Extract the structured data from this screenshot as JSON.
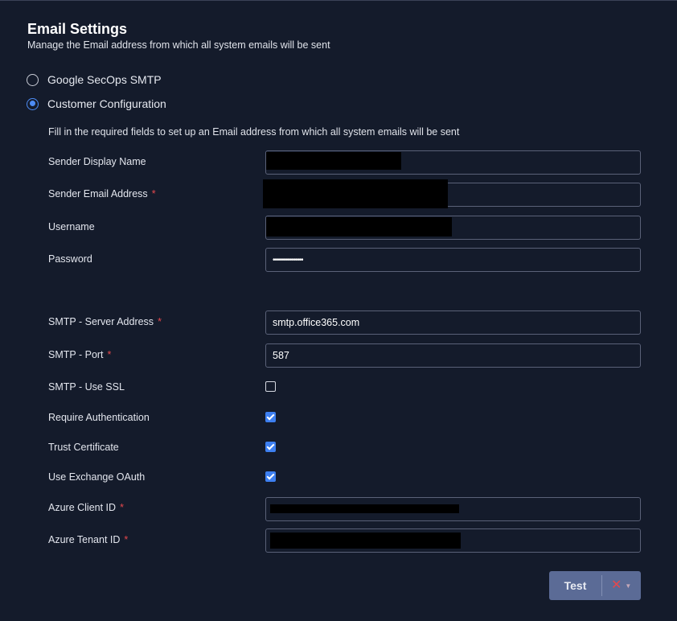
{
  "header": {
    "title": "Email Settings",
    "subtitle": "Manage the Email address from which all system emails will be sent"
  },
  "options": {
    "google": "Google SecOps SMTP",
    "customer": "Customer Configuration",
    "selected": "customer"
  },
  "hint": "Fill in the required fields to set up an Email address from which all system emails will be sent",
  "fields": {
    "sender_display_name": {
      "label": "Sender Display Name",
      "value": ""
    },
    "sender_email": {
      "label": "Sender Email Address",
      "required": "*",
      "value": ""
    },
    "username": {
      "label": "Username",
      "value": ""
    },
    "password": {
      "label": "Password",
      "value": "•••••••••••••••"
    },
    "smtp_server": {
      "label": "SMTP - Server Address",
      "required": "*",
      "value": "smtp.office365.com"
    },
    "smtp_port": {
      "label": "SMTP - Port",
      "required": "*",
      "value": "587"
    },
    "azure_client_id": {
      "label": "Azure Client ID",
      "required": "*",
      "value": ""
    },
    "azure_tenant_id": {
      "label": "Azure Tenant ID",
      "required": "*",
      "value": ""
    }
  },
  "checkboxes": {
    "use_ssl": {
      "label": "SMTP - Use SSL",
      "checked": false
    },
    "require_auth": {
      "label": "Require Authentication",
      "checked": true
    },
    "trust_cert": {
      "label": "Trust Certificate",
      "checked": true
    },
    "exchange_oauth": {
      "label": "Use Exchange OAuth",
      "checked": true
    }
  },
  "actions": {
    "test_label": "Test",
    "status_icon": "x-icon",
    "dropdown_icon": "chevron-down-icon"
  },
  "colors": {
    "background": "#141b2b",
    "accent": "#3d7ff0",
    "required": "#e5484d",
    "button": "#5b6b96"
  }
}
